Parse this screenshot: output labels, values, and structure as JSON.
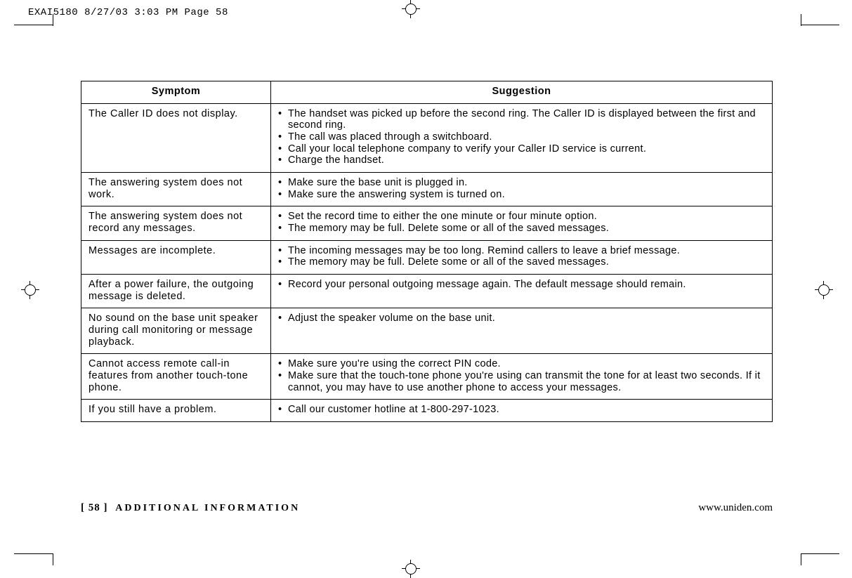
{
  "slug": "EXAI5180  8/27/03 3:03 PM  Page 58",
  "table": {
    "headers": {
      "symptom": "Symptom",
      "suggestion": "Suggestion"
    },
    "rows": [
      {
        "symptom": "The Caller ID does not display.",
        "suggestions": [
          "The handset was picked up before the second ring. The Caller ID is displayed between the first and second ring.",
          "The call was placed through a switchboard.",
          "Call your local telephone company to verify your Caller ID service is current.",
          "Charge the handset."
        ]
      },
      {
        "symptom": "The answering system does not work.",
        "suggestions": [
          "Make sure the base unit is plugged in.",
          "Make sure the answering system is turned on."
        ]
      },
      {
        "symptom": "The answering system does not record any messages.",
        "suggestions": [
          "Set the record time to either the one minute or four minute option.",
          "The memory may be full. Delete some or all of the saved messages."
        ]
      },
      {
        "symptom": "Messages are incomplete.",
        "suggestions": [
          "The incoming messages may be too long. Remind callers to leave a brief message.",
          "The memory may be full. Delete some or all of the saved messages."
        ]
      },
      {
        "symptom": "After a power failure, the outgoing message is deleted.",
        "suggestions": [
          "Record your personal outgoing message again. The default message should remain."
        ]
      },
      {
        "symptom": "No sound on the base unit speaker during call monitoring or message playback.",
        "suggestions": [
          "Adjust the speaker volume on the base unit."
        ]
      },
      {
        "symptom": "Cannot access remote call-in features from another touch-tone phone.",
        "suggestions": [
          "Make sure you're using the correct PIN code.",
          "Make sure that the touch-tone phone you're using can transmit the tone for at least two seconds. If it cannot, you may have to use another phone to access your messages."
        ]
      },
      {
        "symptom": "If you still have a problem.",
        "suggestions": [
          "Call our customer hotline at 1-800-297-1023."
        ]
      }
    ]
  },
  "footer": {
    "page_bracket_open": "[ ",
    "page_number": "58",
    "page_bracket_close": " ]",
    "section": "ADDITIONAL INFORMATION",
    "url": "www.uniden.com"
  }
}
